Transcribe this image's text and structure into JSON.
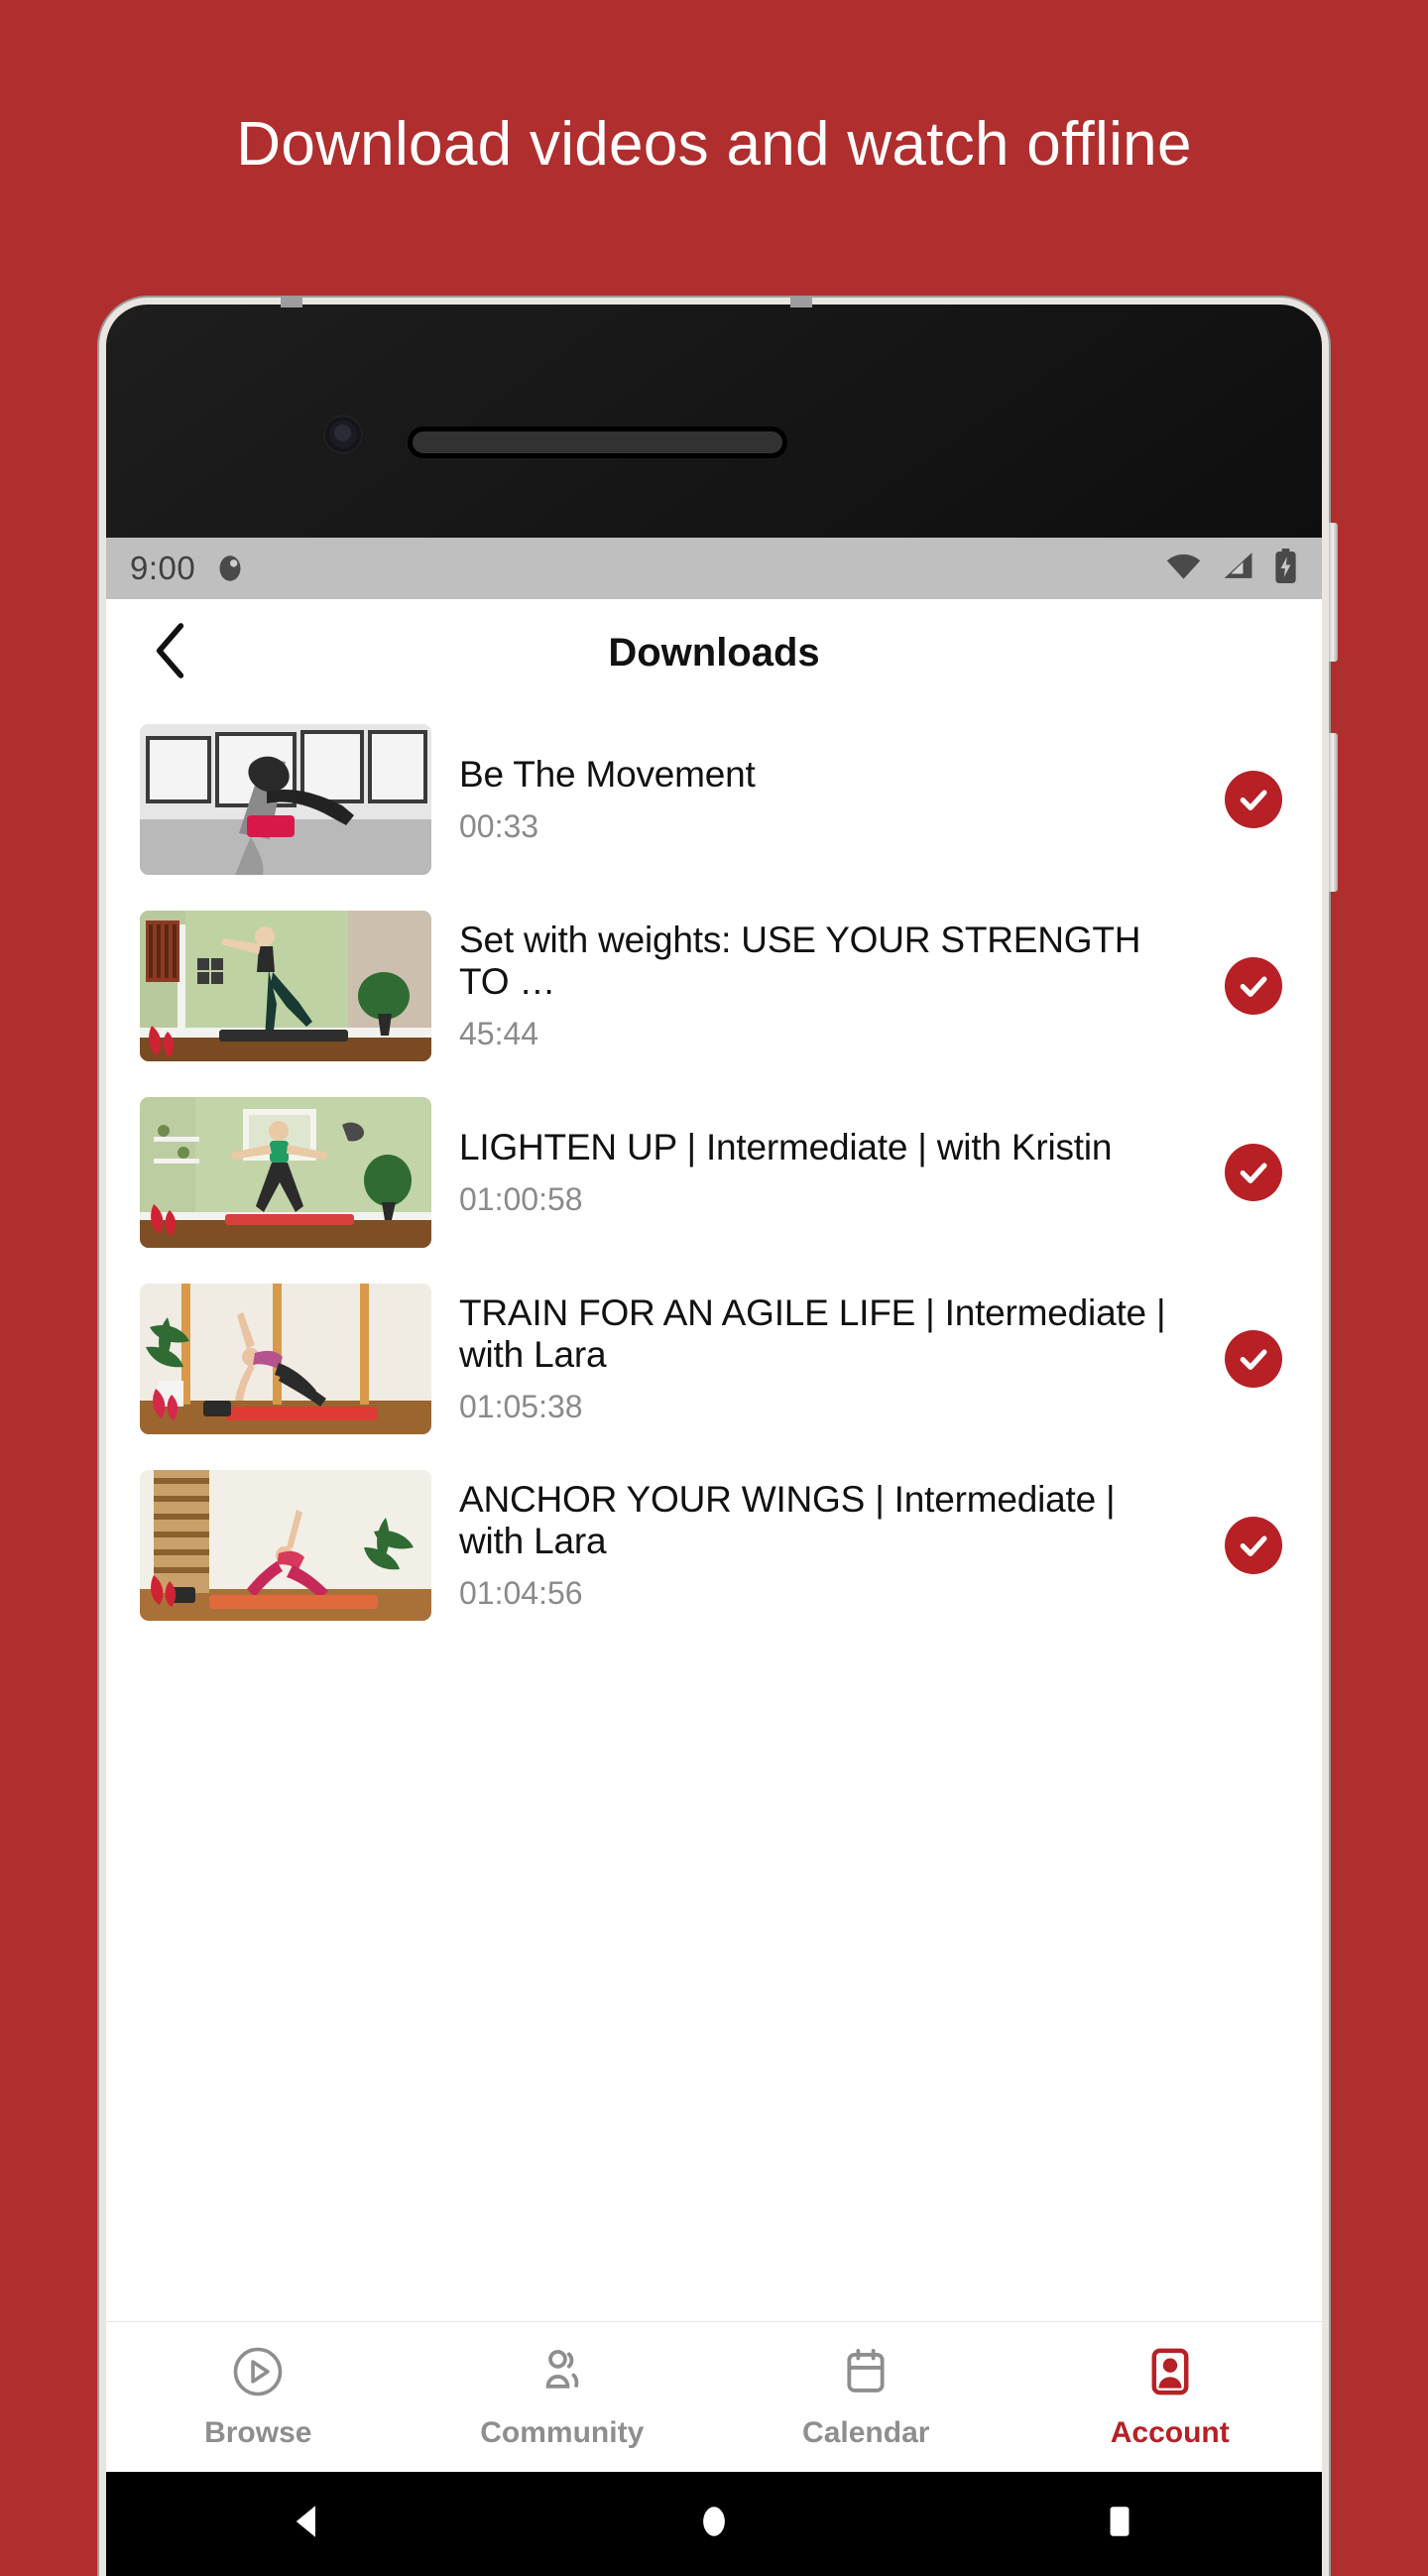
{
  "promo": {
    "headline": "Download videos and watch offline",
    "background_color": "#B02E2E"
  },
  "status_bar": {
    "time": "9:00",
    "notification_icon": "notification-dot-icon",
    "wifi_icon": "wifi-icon",
    "signal_icon": "cellular-signal-icon",
    "battery_icon": "battery-charging-icon"
  },
  "app_header": {
    "back_icon": "chevron-left-icon",
    "title": "Downloads"
  },
  "accent_color": "#B72025",
  "downloads": [
    {
      "title": "Be The Movement",
      "duration": "00:33",
      "status_icon": "check-circle-icon",
      "thumbnail": "bw-studio-handstand"
    },
    {
      "title": "Set with weights: USE YOUR STRENGTH TO …",
      "duration": "45:44",
      "status_icon": "check-circle-icon",
      "thumbnail": "green-wall-standing-balance"
    },
    {
      "title": "LIGHTEN UP | Intermediate | with Kristin",
      "duration": "01:00:58",
      "status_icon": "check-circle-icon",
      "thumbnail": "green-wall-wide-stance"
    },
    {
      "title": "TRAIN FOR AN AGILE LIFE | Intermediate | with Lara",
      "duration": "01:05:38",
      "status_icon": "check-circle-icon",
      "thumbnail": "wood-bars-triangle-pose"
    },
    {
      "title": "ANCHOR YOUR WINGS | Intermediate | with Lara",
      "duration": "01:04:56",
      "status_icon": "check-circle-icon",
      "thumbnail": "wall-bars-down-dog"
    }
  ],
  "tabs": [
    {
      "label": "Browse",
      "icon": "play-circle-icon",
      "active": false
    },
    {
      "label": "Community",
      "icon": "people-icon",
      "active": false
    },
    {
      "label": "Calendar",
      "icon": "calendar-icon",
      "active": false
    },
    {
      "label": "Account",
      "icon": "account-card-icon",
      "active": true
    }
  ],
  "android_nav": {
    "back": "back-triangle-icon",
    "home": "home-circle-icon",
    "recents": "recents-square-icon"
  }
}
